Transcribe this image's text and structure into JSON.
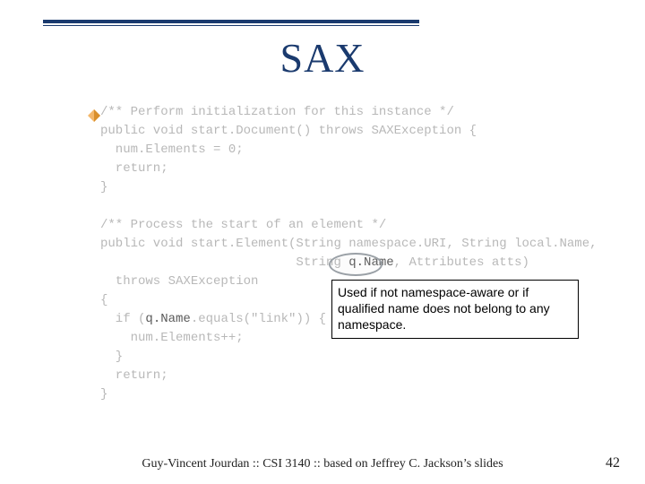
{
  "title": "SAX",
  "code": {
    "l1": "/** Perform initialization for this instance */",
    "l2": "public void start.Document() throws SAXException {",
    "l3": "  num.Elements = 0;",
    "l4": "  return;",
    "l5": "}",
    "l6": "",
    "l7": "/** Process the start of an element */",
    "l8a": "public void start.Element(String namespace.URI, String local.Name,",
    "l8b_indent": "                          String ",
    "l8b_hl": "q.Name",
    "l8b_tail": ", Attributes atts)",
    "l9": "  throws SAXException",
    "l10": "{",
    "l11a": "  if (",
    "l11b": "q.Name",
    "l11c": ".equals(\"link\")) {",
    "l12": "    num.Elements++;",
    "l13": "  }",
    "l14": "  return;",
    "l15": "}"
  },
  "callout": "Used if not namespace-aware or if qualified name does not belong to any namespace.",
  "footer": "Guy-Vincent Jourdan :: CSI 3140 :: based on Jeffrey C. Jackson’s slides",
  "page": "42"
}
